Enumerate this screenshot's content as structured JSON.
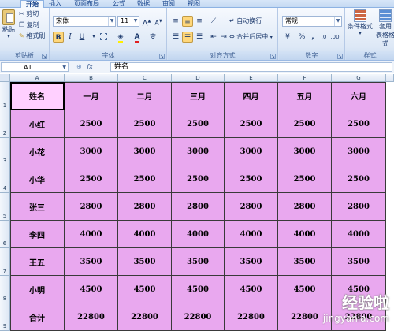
{
  "ribbon_tabs": [
    "开始",
    "插入",
    "页面布局",
    "公式",
    "数据",
    "审阅",
    "视图"
  ],
  "clipboard": {
    "paste": "粘贴",
    "cut": "剪切",
    "copy": "复制",
    "format_painter": "格式刷",
    "title": "剪贴板"
  },
  "font": {
    "name": "宋体",
    "size": "11",
    "title": "字体",
    "bold": "B",
    "italic": "I",
    "underline": "U",
    "grow": "A",
    "shrink": "A",
    "color_letter": "A",
    "phonetic": "变"
  },
  "alignment": {
    "wrap": "自动换行",
    "merge": "合并后居中",
    "title": "对齐方式"
  },
  "number": {
    "format": "常规",
    "percent": "%",
    "comma": ",",
    "title": "数字"
  },
  "styles": {
    "conditional": "条件格式",
    "table_a": "套用",
    "table_b": "表格格式",
    "title": "样式"
  },
  "formula_bar": {
    "cell_ref": "A1",
    "fx": "fx",
    "content": "姓名"
  },
  "columns": [
    "A",
    "B",
    "C",
    "D",
    "E",
    "F",
    "G"
  ],
  "rows": [
    "1",
    "2",
    "3",
    "4",
    "5",
    "6",
    "7",
    "8",
    "9"
  ],
  "table": {
    "header": [
      "姓名",
      "一月",
      "二月",
      "三月",
      "四月",
      "五月",
      "六月"
    ],
    "body": [
      [
        "小红",
        "2500",
        "2500",
        "2500",
        "2500",
        "2500",
        "2500"
      ],
      [
        "小花",
        "3000",
        "3000",
        "3000",
        "3000",
        "3000",
        "3000"
      ],
      [
        "小华",
        "2500",
        "2500",
        "2500",
        "2500",
        "2500",
        "2500"
      ],
      [
        "张三",
        "2800",
        "2800",
        "2800",
        "2800",
        "2800",
        "2800"
      ],
      [
        "李四",
        "4000",
        "4000",
        "4000",
        "4000",
        "4000",
        "4000"
      ],
      [
        "王五",
        "3500",
        "3500",
        "3500",
        "3500",
        "3500",
        "3500"
      ],
      [
        "小明",
        "4500",
        "4500",
        "4500",
        "4500",
        "4500",
        "4500"
      ],
      [
        "合计",
        "22800",
        "22800",
        "22800",
        "22800",
        "22800",
        "22800"
      ]
    ]
  },
  "watermark": {
    "title": "经验啦",
    "url": "jingyanla.com"
  },
  "colors": {
    "cell_fill": "#e9a8ef",
    "selected_fill": "#ffd0ff"
  }
}
